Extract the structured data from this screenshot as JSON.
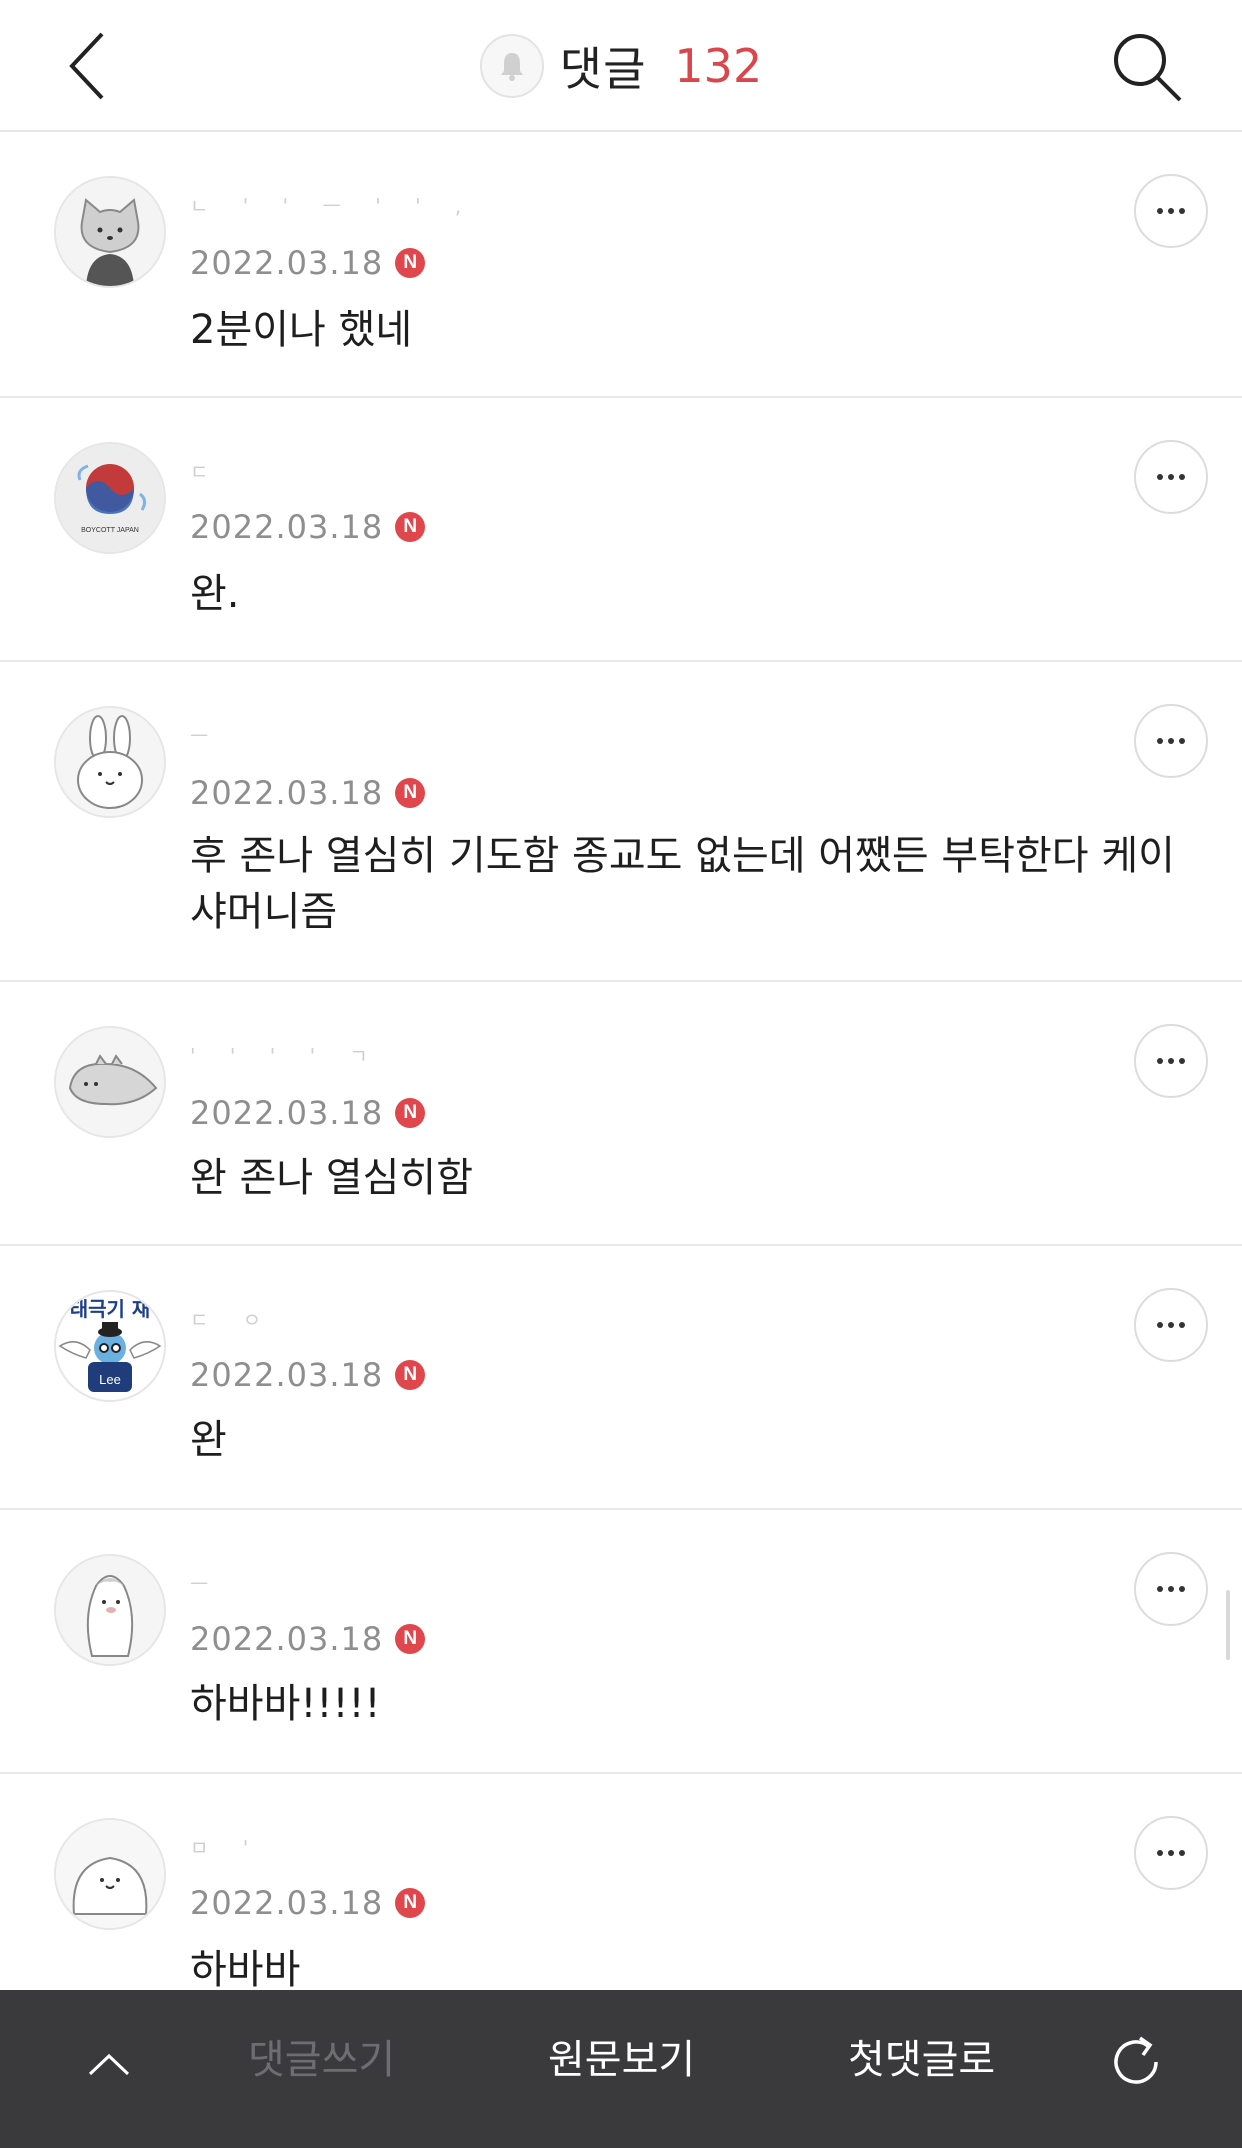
{
  "header": {
    "title": "댓글",
    "count": "132"
  },
  "comments": [
    {
      "name_mask": "ㄴ ' ' ㅡ  '  ' ,",
      "date": "2022.03.18",
      "badge": "N",
      "text": "2분이나 했네",
      "avatar": "cat-avatar"
    },
    {
      "name_mask": "ㄷ",
      "date": "2022.03.18",
      "badge": "N",
      "text": "완.",
      "avatar": "boycott-japan-avatar"
    },
    {
      "name_mask": "ㅡ",
      "date": "2022.03.18",
      "badge": "N",
      "text": "후 존나 열심히 기도함 종교도 없는데 어쨌든 부탁한다 케이샤머니즘",
      "avatar": "rabbit-avatar"
    },
    {
      "name_mask": "'  '  ' ' ㄱ",
      "date": "2022.03.18",
      "badge": "N",
      "text": "완 존나 열심히함",
      "avatar": "dinosaur-avatar"
    },
    {
      "name_mask": "ㄷ ㅇ",
      "date": "2022.03.18",
      "badge": "N",
      "text": "완",
      "avatar": "flag-character-avatar"
    },
    {
      "name_mask": "ㅡ",
      "date": "2022.03.18",
      "badge": "N",
      "text": "하바바!!!!!",
      "avatar": "penguin-avatar"
    },
    {
      "name_mask": "ㅁ '",
      "date": "2022.03.18",
      "badge": "N",
      "text": "하바바",
      "avatar": "seal-avatar"
    }
  ],
  "avatar_labels": {
    "boycott": "BOYCOTT JAPAN",
    "flag_top": "태극기 재",
    "flag_shirt": "Lee"
  },
  "toolbar": {
    "write": "댓글쓰기",
    "origin": "원문보기",
    "first": "첫댓글로"
  },
  "colors": {
    "accent": "#d9464b",
    "badge": "#e0474c",
    "toolbar_bg": "#3a3a3d"
  }
}
